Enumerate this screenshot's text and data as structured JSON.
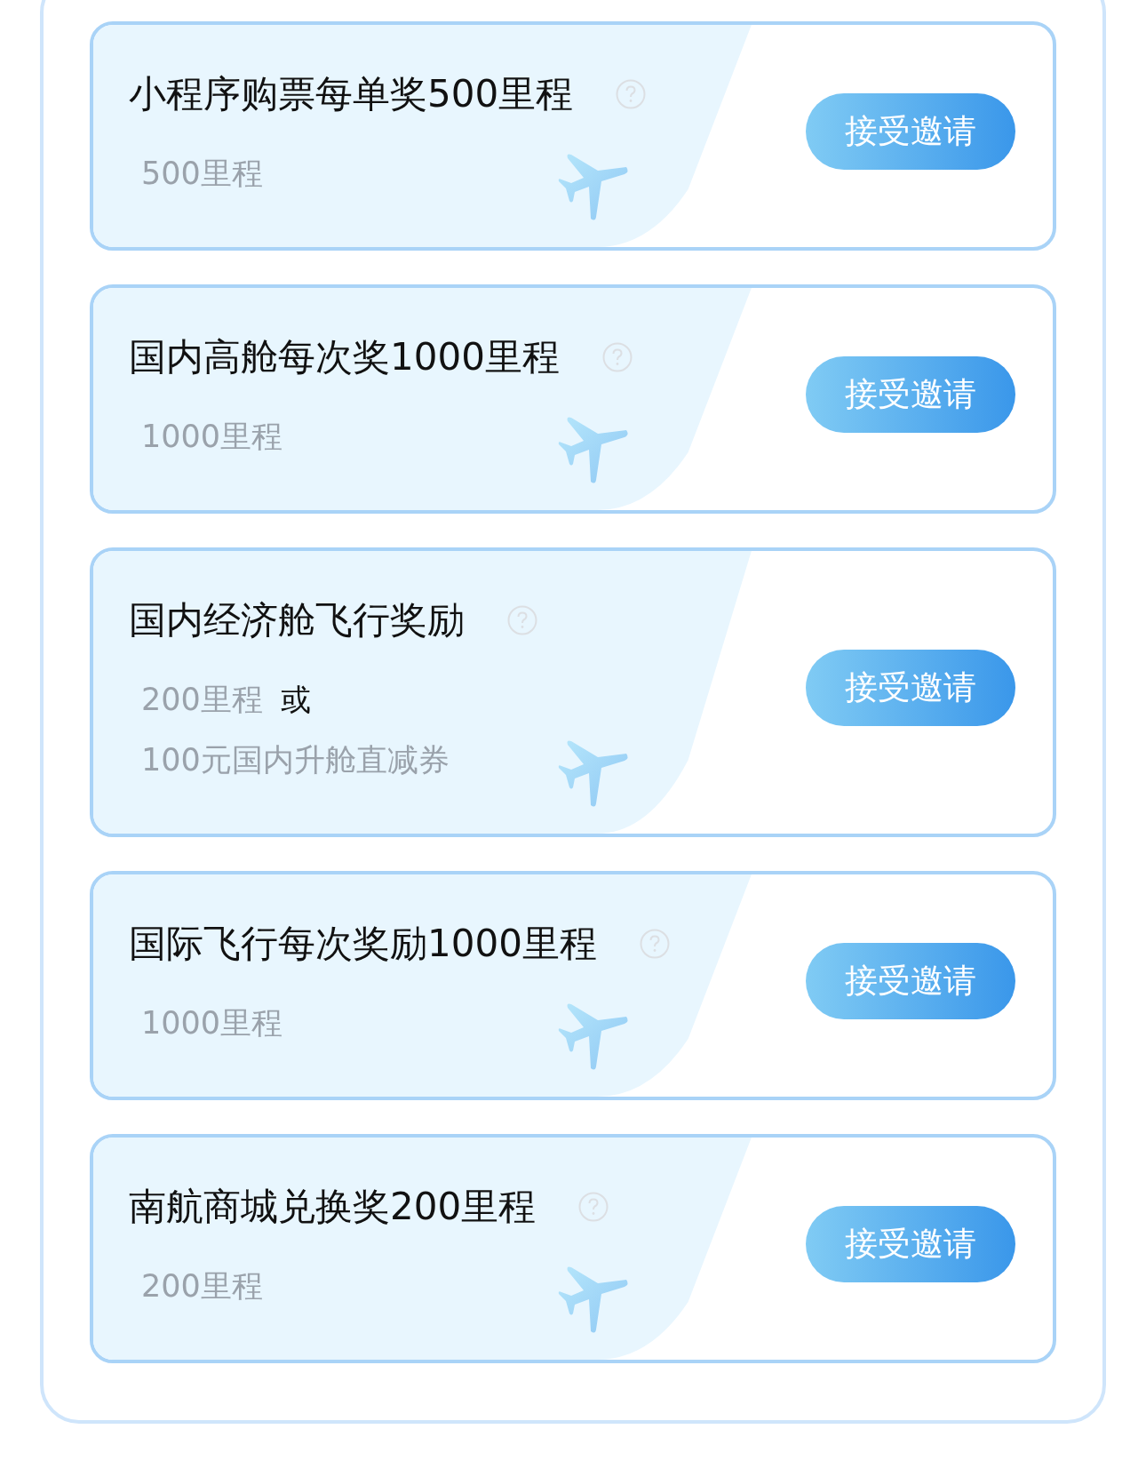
{
  "tasks": [
    {
      "title": "小程序购票每单奖500里程",
      "rewards": [
        "500里程"
      ],
      "button": "接受邀请"
    },
    {
      "title": "国内高舱每次奖1000里程",
      "rewards": [
        "1000里程"
      ],
      "button": "接受邀请"
    },
    {
      "title": "国内经济舱飞行奖励",
      "rewards": [
        "200里程",
        "100元国内升舱直减券"
      ],
      "separator": "或",
      "button": "接受邀请"
    },
    {
      "title": "国际飞行每次奖励1000里程",
      "rewards": [
        "1000里程"
      ],
      "button": "接受邀请"
    },
    {
      "title": "南航商城兑换奖200里程",
      "rewards": [
        "200里程"
      ],
      "button": "接受邀请"
    }
  ]
}
